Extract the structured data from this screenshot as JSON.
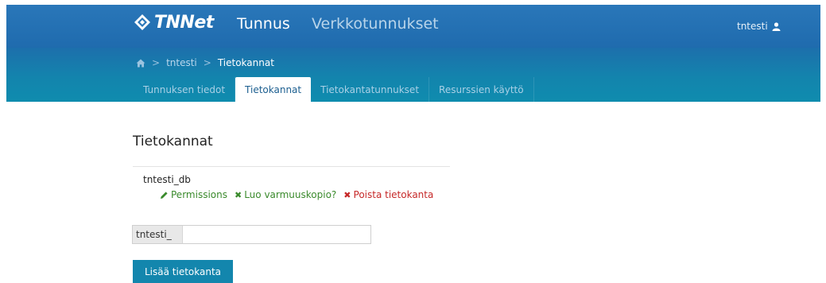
{
  "header": {
    "logo_text": "TNNet",
    "app_title": "Tunnus",
    "app_subtitle": "Verkkotunnukset",
    "user": "tntesti",
    "user_icon": "user-icon"
  },
  "breadcrumb": {
    "home_icon": "home-icon",
    "items": [
      "tntesti",
      "Tietokannat"
    ]
  },
  "tabs": [
    {
      "label": "Tunnuksen tiedot",
      "active": false
    },
    {
      "label": "Tietokannat",
      "active": true
    },
    {
      "label": "Tietokantatunnukset",
      "active": false
    },
    {
      "label": "Resurssien käyttö",
      "active": false
    }
  ],
  "main": {
    "heading": "Tietokannat",
    "database": {
      "name": "tntesti_db",
      "actions": {
        "permissions": "Permissions",
        "backup": "Luo varmuuskopio?",
        "delete": "Poista tietokanta"
      }
    },
    "new_db": {
      "prefix": "tntesti_",
      "value": "",
      "button": "Lisää tietokanta"
    }
  },
  "colors": {
    "header": "#1f6bae",
    "subheader": "#1384ad",
    "action_green": "#3a8a2c",
    "action_red": "#c62828",
    "button": "#1386ad"
  }
}
